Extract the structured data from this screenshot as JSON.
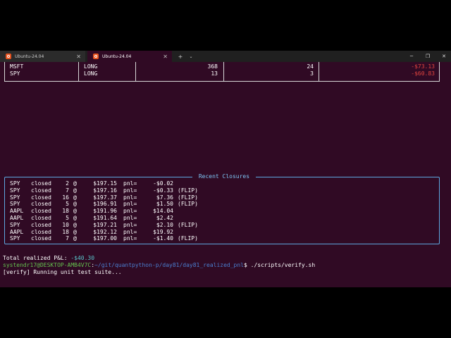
{
  "tabs": [
    {
      "label": "Ubuntu-24.04",
      "active": false
    },
    {
      "label": "Ubuntu-24.04",
      "active": true
    }
  ],
  "tabbar": {
    "new_tab": "+",
    "dropdown": "⌄",
    "close": "✕"
  },
  "window_controls": {
    "minimize": "─",
    "maximize": "❐",
    "close": "✕"
  },
  "positions": [
    {
      "symbol": "MSFT",
      "side": "LONG",
      "qty": "368",
      "col4": "24",
      "pnl": "-$73.13"
    },
    {
      "symbol": "SPY",
      "side": "LONG",
      "qty": "13",
      "col4": "3",
      "pnl": "-$60.83"
    }
  ],
  "closures": {
    "title": " Recent Closures ",
    "rows": [
      {
        "sym": "SPY",
        "act": "closed",
        "qty": "2",
        "at": "@",
        "px": "$197.15",
        "pl": "pnl=",
        "pnl": "-$0.02",
        "note": ""
      },
      {
        "sym": "SPY",
        "act": "closed",
        "qty": "7",
        "at": "@",
        "px": "$197.16",
        "pl": "pnl=",
        "pnl": "-$0.33",
        "note": "(FLIP)"
      },
      {
        "sym": "SPY",
        "act": "closed",
        "qty": "16",
        "at": "@",
        "px": "$197.37",
        "pl": "pnl=",
        "pnl": "$7.36",
        "note": "(FLIP)"
      },
      {
        "sym": "SPY",
        "act": "closed",
        "qty": "5",
        "at": "@",
        "px": "$196.91",
        "pl": "pnl=",
        "pnl": "$1.50",
        "note": "(FLIP)"
      },
      {
        "sym": "AAPL",
        "act": "closed",
        "qty": "18",
        "at": "@",
        "px": "$191.96",
        "pl": "pnl=",
        "pnl": "$14.04",
        "note": ""
      },
      {
        "sym": "AAPL",
        "act": "closed",
        "qty": "5",
        "at": "@",
        "px": "$191.64",
        "pl": "pnl=",
        "pnl": "$2.42",
        "note": ""
      },
      {
        "sym": "SPY",
        "act": "closed",
        "qty": "10",
        "at": "@",
        "px": "$197.21",
        "pl": "pnl=",
        "pnl": "$2.10",
        "note": "(FLIP)"
      },
      {
        "sym": "AAPL",
        "act": "closed",
        "qty": "18",
        "at": "@",
        "px": "$192.12",
        "pl": "pnl=",
        "pnl": "$19.92",
        "note": ""
      },
      {
        "sym": "SPY",
        "act": "closed",
        "qty": "7",
        "at": "@",
        "px": "$197.00",
        "pl": "pnl=",
        "pnl": "-$1.40",
        "note": "(FLIP)"
      }
    ]
  },
  "summary": {
    "label": "Total realized P&L: ",
    "value": "-$40.30"
  },
  "prompt": {
    "user": "systendr17@DESKTOP-AMB4V7C",
    "sep": ":",
    "path": "~/git/quantpython-p/day81/day81_realized_pnl",
    "dollar": "$ ",
    "command": "./scripts/verify.sh"
  },
  "output": {
    "line1": "[verify] Running unit test suite..."
  },
  "colors": {
    "background": "#300a24",
    "negative": "#e0443f",
    "panel_border": "#5ea8e0",
    "prompt_user": "#64c24f",
    "prompt_path": "#4a7fd0"
  }
}
